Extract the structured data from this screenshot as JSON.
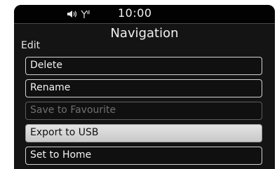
{
  "status": {
    "time": "10:00",
    "icons": [
      "volume-icon",
      "antenna-icon"
    ]
  },
  "header": {
    "title": "Navigation",
    "section": "Edit"
  },
  "menu": {
    "items": [
      {
        "label": "Delete",
        "state": "normal"
      },
      {
        "label": "Rename",
        "state": "normal"
      },
      {
        "label": "Save to Favourite",
        "state": "disabled"
      },
      {
        "label": "Export to USB",
        "state": "selected"
      },
      {
        "label": "Set to Home",
        "state": "normal"
      }
    ]
  }
}
